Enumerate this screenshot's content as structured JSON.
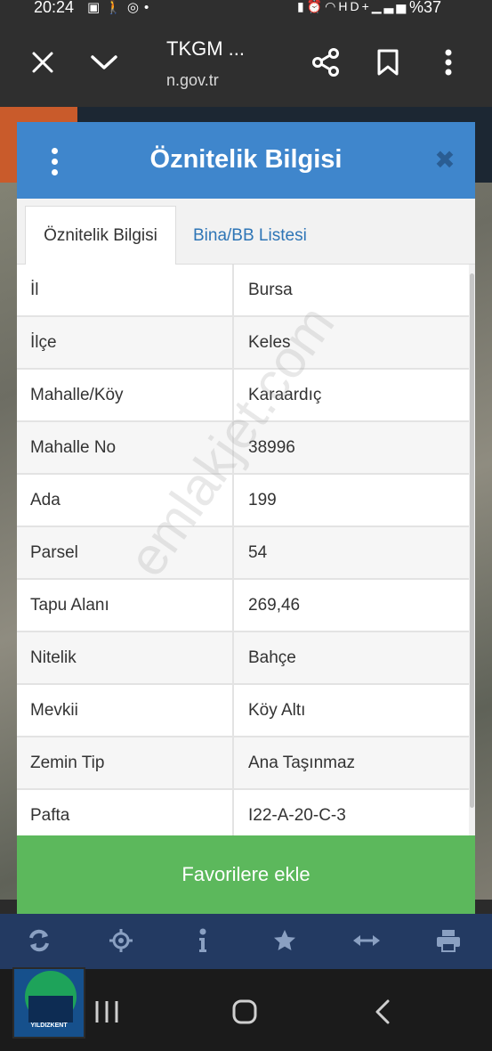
{
  "status_bar": {
    "time": "20:24",
    "left_icons": [
      "image-icon",
      "walk-icon",
      "chrome-icon",
      "dot-icon"
    ],
    "right_icons": [
      "nfc-icon",
      "alarm-icon",
      "wifi-icon",
      "hd-icon",
      "signal-icon"
    ],
    "battery": "%37"
  },
  "browser": {
    "title": "TKGM ...",
    "url": "n.gov.tr",
    "buttons": [
      "close-icon",
      "chevron-down-icon",
      "share-icon",
      "bookmark-icon",
      "more-icon"
    ]
  },
  "dialog": {
    "title": "Öznitelik Bilgisi",
    "tabs": [
      {
        "label": "Öznitelik Bilgisi",
        "active": true
      },
      {
        "label": "Bina/BB Listesi",
        "active": false
      }
    ],
    "rows": [
      {
        "key": "İl",
        "value": "Bursa"
      },
      {
        "key": "İlçe",
        "value": "Keles"
      },
      {
        "key": "Mahalle/Köy",
        "value": "Karaardıç"
      },
      {
        "key": "Mahalle No",
        "value": "38996"
      },
      {
        "key": "Ada",
        "value": "199"
      },
      {
        "key": "Parsel",
        "value": "54"
      },
      {
        "key": "Tapu Alanı",
        "value": "269,46"
      },
      {
        "key": "Nitelik",
        "value": "Bahçe"
      },
      {
        "key": "Mevkii",
        "value": "Köy Altı"
      },
      {
        "key": "Zemin Tip",
        "value": "Ana Taşınmaz"
      },
      {
        "key": "Pafta",
        "value": "I22-A-20-C-3"
      }
    ],
    "favorite_button": "Favorilere ekle"
  },
  "watermark": "emlakjet.com",
  "map_toolbar": [
    "refresh-icon",
    "locate-icon",
    "info-icon",
    "star-icon",
    "measure-icon",
    "print-icon"
  ],
  "nav_bar": [
    "recents-icon",
    "home-icon",
    "back-icon"
  ],
  "logo_text": "YILDIZKENT",
  "colors": {
    "header_blue": "#3f86cc",
    "button_green": "#5cb85c",
    "toolbar_navy": "#233a62",
    "link_blue": "#2e75b6"
  }
}
